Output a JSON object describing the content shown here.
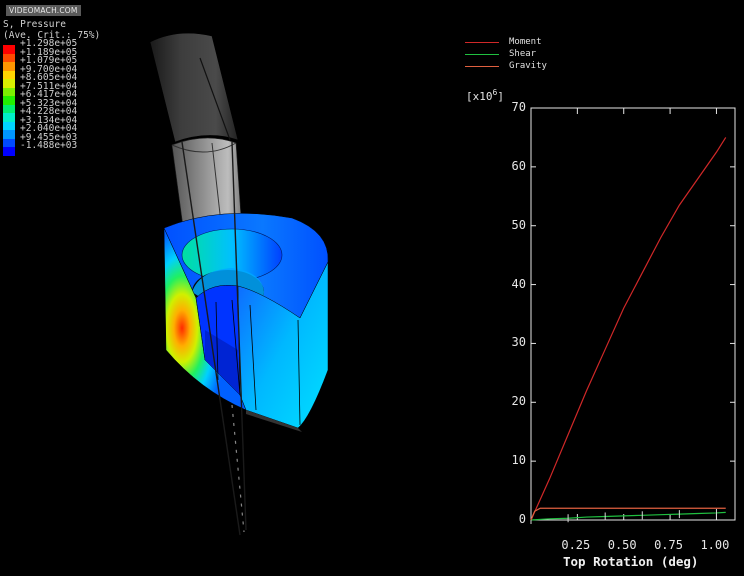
{
  "watermark": "VIDEOMACH.COM",
  "contour_legend": {
    "title": "S, Pressure",
    "subtitle": "(Ave. Crit.: 75%)",
    "colors": [
      "#ff0000",
      "#ff4a00",
      "#ff9600",
      "#ffd400",
      "#d8f000",
      "#7cf000",
      "#22f000",
      "#00f070",
      "#00f0c8",
      "#00d4ff",
      "#0096ff",
      "#004aff",
      "#0000ff"
    ],
    "labels": [
      "+1.298e+05",
      "+1.189e+05",
      "+1.079e+05",
      "+9.700e+04",
      "+8.605e+04",
      "+7.511e+04",
      "+6.417e+04",
      "+5.323e+04",
      "+4.228e+04",
      "+3.134e+04",
      "+2.040e+04",
      "+9.455e+03",
      "-1.488e+03"
    ]
  },
  "plot_legend": [
    {
      "name": "Moment",
      "color": "#d02828"
    },
    {
      "name": "Shear",
      "color": "#20c040"
    },
    {
      "name": "Gravity",
      "color": "#e06040"
    }
  ],
  "chart_data": {
    "type": "line",
    "xlabel": "Top Rotation (deg)",
    "ylabel": "",
    "scale_label": "[x10",
    "scale_exp": "6",
    "scale_close": "]",
    "xlim": [
      0,
      1.1
    ],
    "ylim": [
      0,
      70
    ],
    "x_ticks": [
      "0.25",
      "0.50",
      "0.75",
      "1.00"
    ],
    "x_tick_values": [
      0.25,
      0.5,
      0.75,
      1.0
    ],
    "y_ticks": [
      "0",
      "10",
      "20",
      "30",
      "40",
      "50",
      "60",
      "70"
    ],
    "y_tick_values": [
      0,
      10,
      20,
      30,
      40,
      50,
      60,
      70
    ],
    "series": [
      {
        "name": "Moment",
        "color": "#d02828",
        "x": [
          0,
          0.1,
          0.2,
          0.3,
          0.4,
          0.5,
          0.6,
          0.7,
          0.8,
          0.9,
          1.0,
          1.05
        ],
        "y": [
          0,
          7,
          14.5,
          22,
          29,
          36,
          42,
          48,
          53.5,
          58,
          62.5,
          65
        ]
      },
      {
        "name": "Shear",
        "color": "#20c040",
        "x": [
          0,
          0.1,
          0.2,
          0.3,
          0.4,
          0.5,
          0.6,
          0.7,
          0.8,
          0.9,
          1.0,
          1.05
        ],
        "y": [
          0,
          0.2,
          0.3,
          0.5,
          0.6,
          0.7,
          0.8,
          0.9,
          1.0,
          1.1,
          1.2,
          1.3
        ]
      },
      {
        "name": "Gravity",
        "color": "#e06040",
        "x": [
          0,
          0.02,
          0.05,
          0.1,
          0.3,
          0.5,
          0.7,
          0.9,
          1.05
        ],
        "y": [
          0,
          1.5,
          2.0,
          2.0,
          2.0,
          2.0,
          2.0,
          2.0,
          2.0
        ]
      }
    ]
  }
}
